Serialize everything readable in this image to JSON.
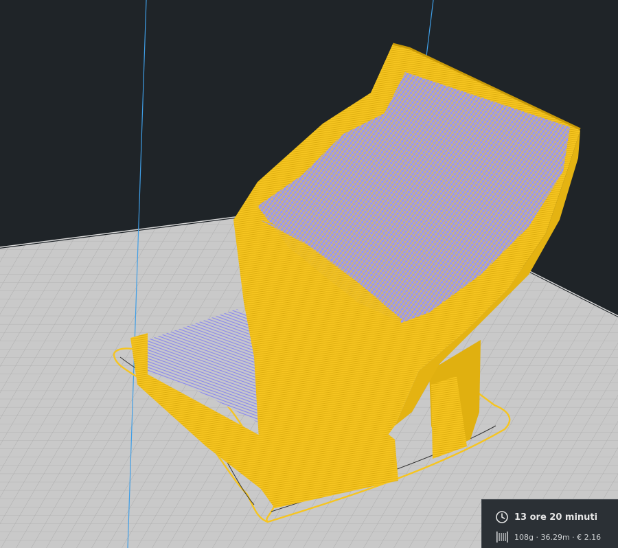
{
  "colors": {
    "background": "#1f2428",
    "build_plate": "#c9c9c9",
    "grid_line": "#a8a8a8",
    "model": "#f6c520",
    "model_shade": "#d9a80c",
    "travel_moves": "#8a88f0",
    "axis_line": "#3f9ee6",
    "panel": "#2b3035"
  },
  "viewport": {
    "icons": {
      "time": "clock-icon",
      "material": "filament-spool-icon"
    }
  },
  "print_info": {
    "time": "13 ore 20 minuti",
    "material": "108g · 36.29m · € 2.16"
  }
}
